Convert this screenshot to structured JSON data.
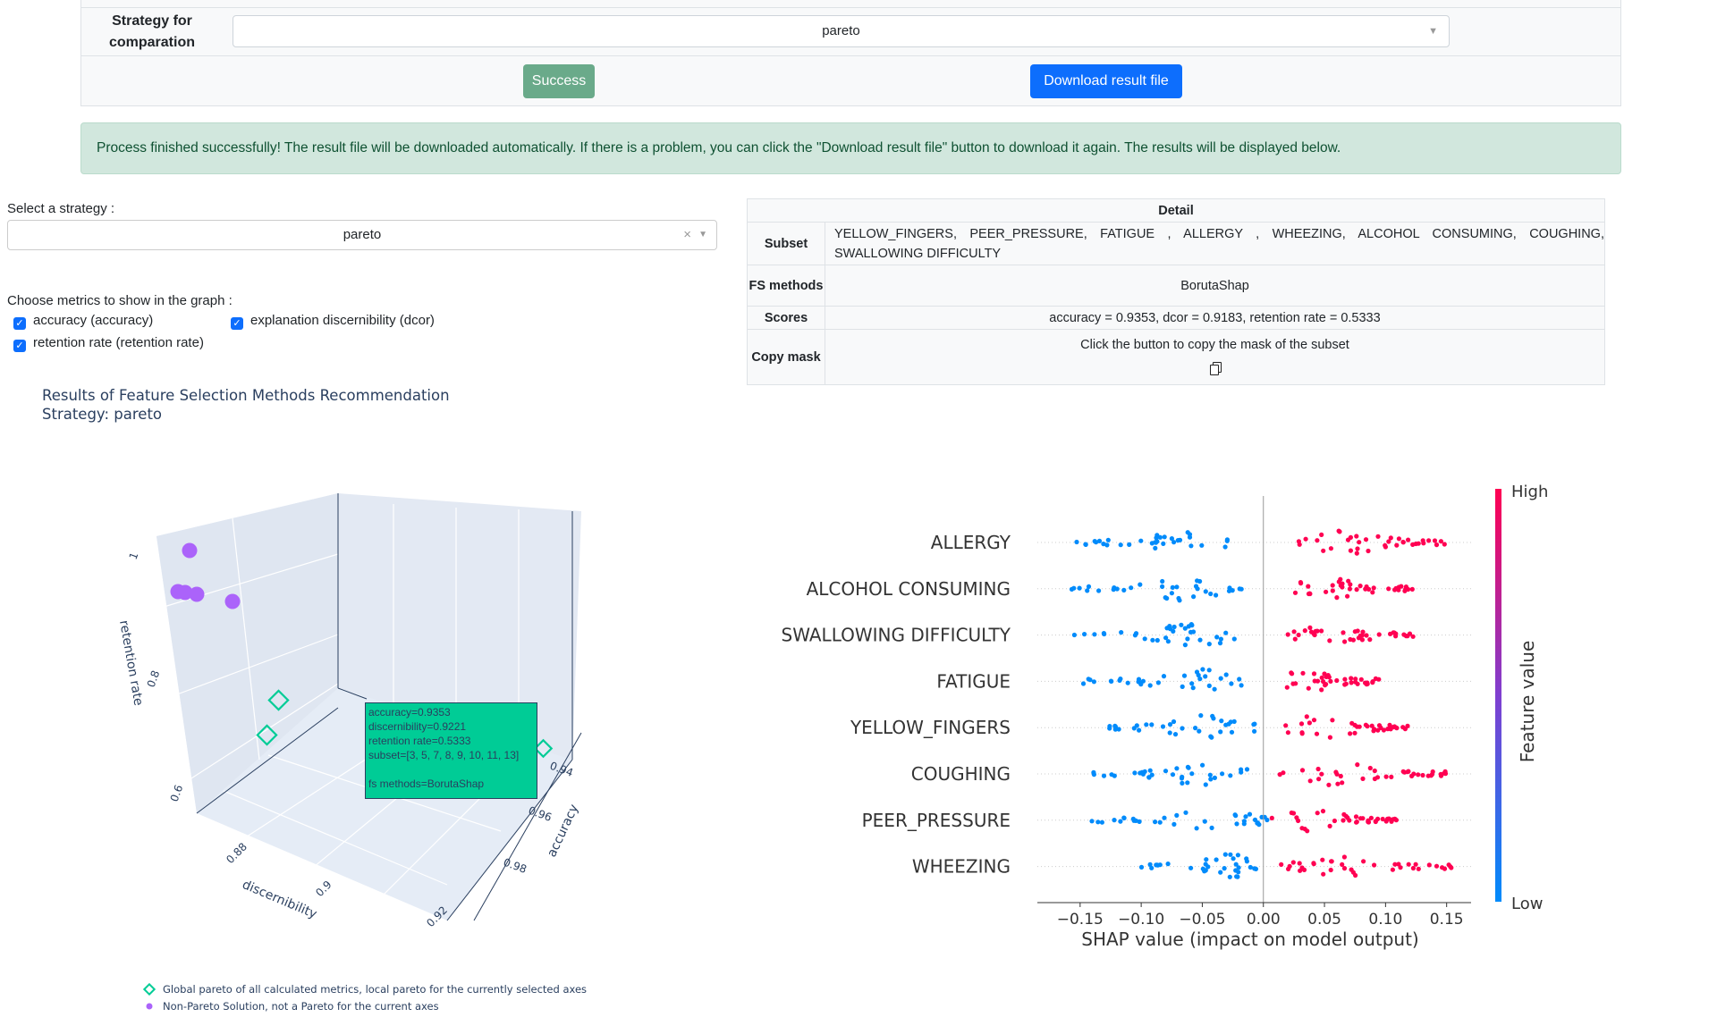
{
  "form": {
    "strategy_label": "Strategy for comparation",
    "strategy_value": "pareto",
    "success_label": "Success",
    "download_label": "Download result file"
  },
  "alert": {
    "message": "Process finished successfully! The result file will be downloaded automatically. If there is a problem, you can click the \"Download result file\" button to download it again. The results will be displayed below."
  },
  "controls": {
    "select_label": "Select a strategy :",
    "select_value": "pareto",
    "metrics_label": "Choose metrics to show in the graph :",
    "metrics": [
      {
        "label": "accuracy (accuracy)",
        "checked": true
      },
      {
        "label": "explanation discernibility (dcor)",
        "checked": true
      },
      {
        "label": "retention rate (retention rate)",
        "checked": true
      }
    ]
  },
  "detail": {
    "title": "Detail",
    "subset_label": "Subset",
    "subset_value": "YELLOW_FINGERS,  PEER_PRESSURE,  FATIGUE  ,  ALLERGY  ,  WHEEZING,  ALCOHOL  CONSUMING,  COUGHING,  SWALLOWING DIFFICULTY",
    "fs_label": "FS methods",
    "fs_value": "BorutaShap",
    "scores_label": "Scores",
    "scores_value": "accuracy = 0.9353, dcor = 0.9183, retention rate = 0.5333",
    "copy_label": "Copy mask",
    "copy_text": "Click the button to copy the mask of the subset",
    "copy_icon": "copy-icon"
  },
  "plot3d": {
    "title_line1": "Results of Feature Selection Methods Recommendation",
    "title_line2": "Strategy: pareto",
    "axis_retention": "retention rate",
    "axis_discern": "discernibility",
    "axis_accuracy": "accuracy",
    "ticks_retention": [
      "1",
      "0.8",
      "0.6"
    ],
    "ticks_discern": [
      "0.88",
      "0.9",
      "0.92"
    ],
    "ticks_accuracy": [
      "0.94",
      "0.96",
      "0.98"
    ],
    "tooltip": "accuracy=0.9353\ndiscernibility=0.9221\nretention rate=0.5333\nsubset=[3, 5, 7, 8, 9, 10, 11, 13]\n\nfs methods=BorutaShap",
    "legend_pareto": "Global pareto of all calculated metrics, local pareto for the currently selected axes",
    "legend_nonpareto": "Non-Pareto Solution, not a Pareto for the current axes",
    "colors": {
      "pareto": "#00cc96",
      "non_pareto": "#ab63fa",
      "bg": "#e5ecf6"
    }
  },
  "chart_data": {
    "type": "scatter",
    "title": "",
    "xlabel": "SHAP value (impact on model output)",
    "ylabel": "",
    "xlim": [
      -0.185,
      0.17
    ],
    "xticks": [
      "−0.15",
      "−0.10",
      "−0.05",
      "0.00",
      "0.05",
      "0.10",
      "0.15"
    ],
    "xtick_values": [
      -0.15,
      -0.1,
      -0.05,
      0.0,
      0.05,
      0.1,
      0.15
    ],
    "features": [
      "ALLERGY",
      "ALCOHOL CONSUMING",
      "SWALLOWING DIFFICULTY",
      "FATIGUE",
      "YELLOW_FINGERS",
      "COUGHING",
      "PEER_PRESSURE",
      "WHEEZING"
    ],
    "colorbar": {
      "high": "High",
      "low": "Low",
      "label": "Feature value",
      "high_color": "#ff0052",
      "low_color": "#008bfb"
    },
    "low_range": [
      [
        -0.17,
        -0.025
      ],
      [
        -0.17,
        -0.015
      ],
      [
        -0.155,
        -0.02
      ],
      [
        -0.15,
        -0.015
      ],
      [
        -0.155,
        -0.005
      ],
      [
        -0.15,
        -0.01
      ],
      [
        -0.145,
        0.005
      ],
      [
        -0.11,
        -0.005
      ]
    ],
    "high_range": [
      [
        0.025,
        0.155
      ],
      [
        0.01,
        0.125
      ],
      [
        0.02,
        0.125
      ],
      [
        0.01,
        0.095
      ],
      [
        0.01,
        0.12
      ],
      [
        0.01,
        0.15
      ],
      [
        0.0,
        0.11
      ],
      [
        0.01,
        0.155
      ]
    ]
  }
}
